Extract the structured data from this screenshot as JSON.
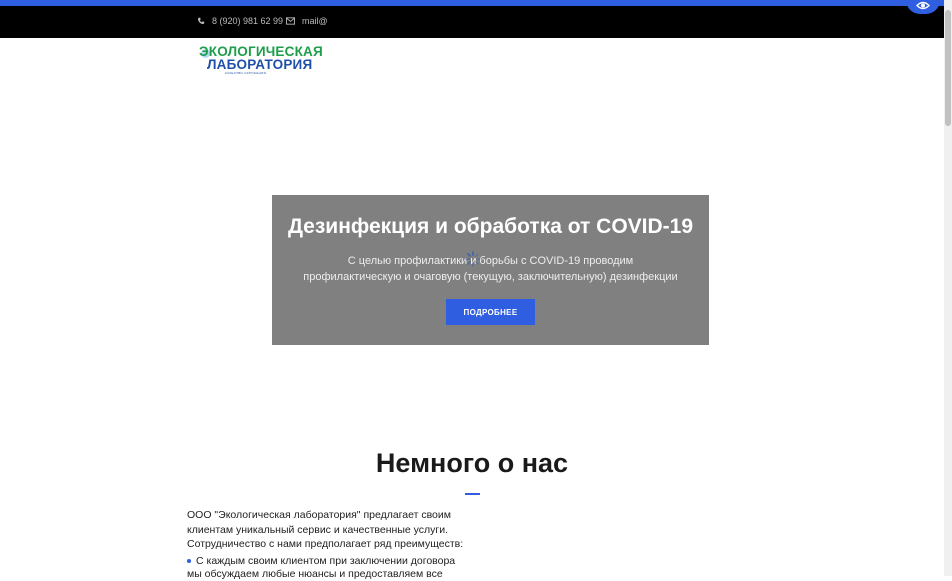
{
  "topbar": {
    "phone": "8 (920) 981 62 99",
    "email": "mail@"
  },
  "logo": {
    "line1": "ЭКОЛОГИЧЕСКАЯ",
    "line2": "ЛАБОРАТОРИЯ",
    "tagline": "КАЧЕСТВО ОКРУЖЕНИЯ"
  },
  "hero": {
    "title": "Дезинфекция и обработка от COVID-19",
    "text": "С целью профилактики и борьбы с COVID-19 проводим профилактическую и очаговую (текущую, заключительную) дезинфекции",
    "button": "ПОДРОБНЕЕ"
  },
  "about": {
    "title": "Немного о нас",
    "text": "ООО \"Экологическая лаборатория\" предлагает своим клиентам уникальный сервис и качественные услуги. Сотрудничество с нами предполагает ряд преимуществ:",
    "list_item_1": "С каждым своим клиентом при заключении договора мы обсуждаем любые нюансы и предоставляем все"
  },
  "colors": {
    "accent": "#2f5fe0",
    "topbar": "#000000",
    "hero_bg": "#808080"
  },
  "icons": [
    "phone-icon",
    "mail-icon",
    "eye-icon",
    "loading-spinner-icon"
  ]
}
